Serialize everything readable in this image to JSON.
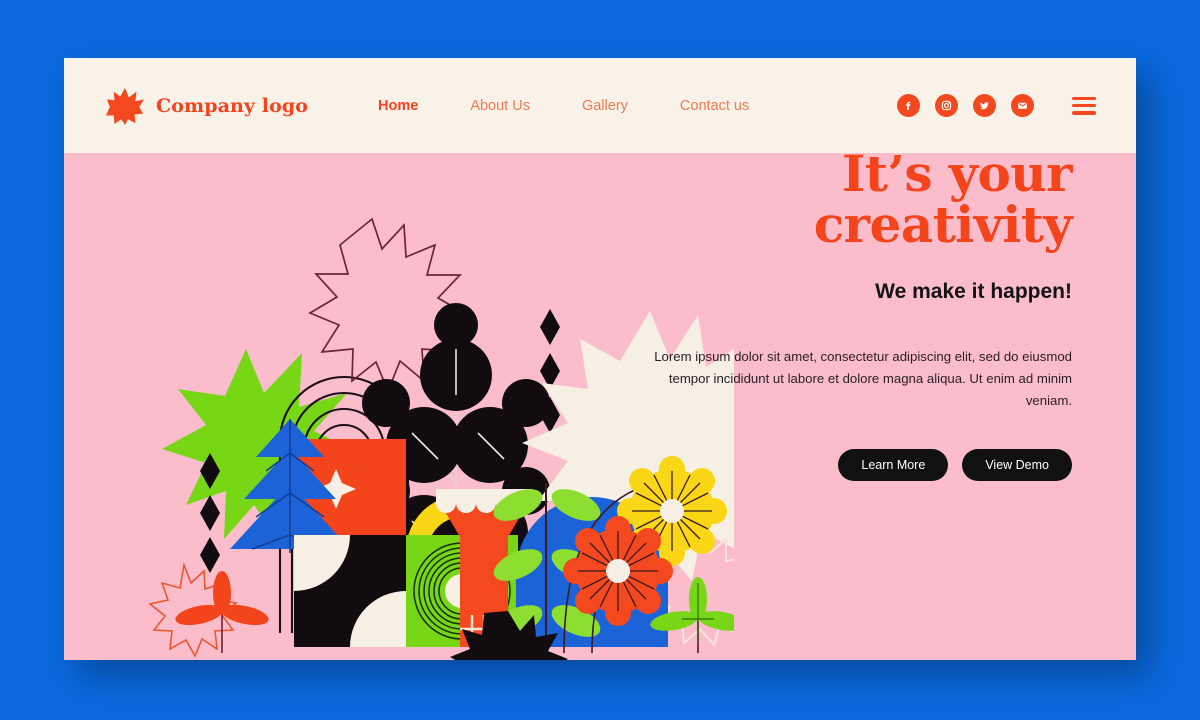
{
  "theme": {
    "backdrop": "#0a69de",
    "card_bg": "#f9f2e9",
    "hero_bg": "#fbbdcb",
    "accent_orange": "#f4441b",
    "nav_muted": "#ef7a55",
    "cream": "#f6efe3",
    "green": "#77d615",
    "blue": "#1d63d8",
    "yellow": "#f9d616",
    "black": "#111111"
  },
  "header": {
    "brand": {
      "icon": "starburst-icon",
      "name": "Company logo"
    },
    "nav": [
      {
        "label": "Home",
        "active": true
      },
      {
        "label": "About Us",
        "active": false
      },
      {
        "label": "Gallery",
        "active": false
      },
      {
        "label": "Contact us",
        "active": false
      }
    ],
    "socials": [
      {
        "name": "facebook-icon"
      },
      {
        "name": "instagram-icon"
      },
      {
        "name": "twitter-icon"
      },
      {
        "name": "email-icon"
      }
    ],
    "menu_icon": "hamburger-menu-icon"
  },
  "hero": {
    "headline_line1": "It’s your",
    "headline_line2": "creativity",
    "subheadline": "We make it happen!",
    "body": "Lorem ipsum dolor sit amet, consectetur adipiscing elit, sed do eiusmod tempor incididunt ut labore et dolore magna aliqua. Ut enim ad minim veniam.",
    "primary_button": "Learn More",
    "secondary_button": "View Demo"
  },
  "illustration": {
    "description": "Geometric bauhaus-style composition of plants, flowers and abstract shapes",
    "elements": [
      "green-starburst",
      "black-nested-arches",
      "outlined-star-top",
      "black-circle-plant",
      "cream-starburst",
      "diamond-stack",
      "orange-square-with-star",
      "yellow-rainbow-arc",
      "blue-pine-tree",
      "checker-circle-tiles",
      "green-square-spiral",
      "orange-column",
      "orange-flower",
      "yellow-flower",
      "blue-dome",
      "leafy-stem",
      "green-sprout",
      "black-star",
      "orange-leaf-sprig",
      "outlined-star-left"
    ]
  }
}
